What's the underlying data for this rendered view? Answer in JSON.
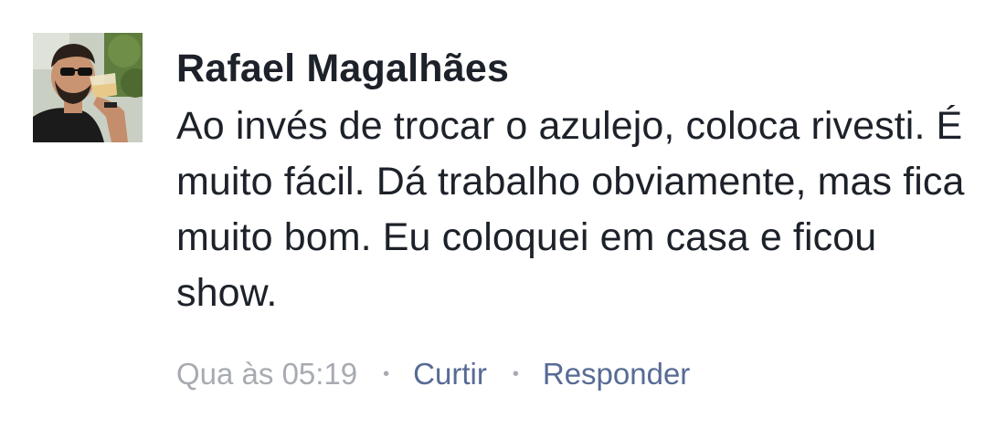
{
  "comment": {
    "author": "Rafael Magalhães",
    "text": "Ao invés de trocar o azulejo, coloca rivesti. É muito fácil. Dá trabalho obviamente, mas fica muito bom. Eu coloquei em casa e ficou show.",
    "time": "Qua às 05:19",
    "separator": "•",
    "like_label": "Curtir",
    "reply_label": "Responder"
  },
  "colors": {
    "text": "#1d2129",
    "meta": "#a7abb1",
    "link": "#576b95"
  }
}
